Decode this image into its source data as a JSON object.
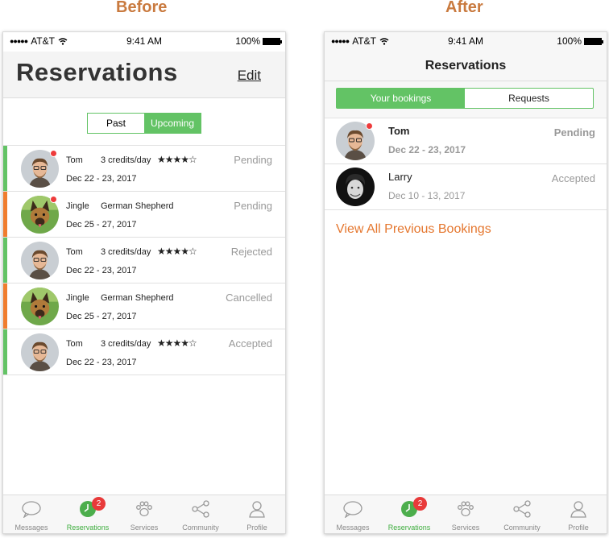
{
  "captions": {
    "before": "Before",
    "after": "After"
  },
  "statusbar": {
    "carrier": "AT&T",
    "time": "9:41 AM",
    "battery": "100%"
  },
  "before": {
    "title": "Reservations",
    "edit_label": "Edit",
    "segment": {
      "left": "Past",
      "right": "Upcoming"
    },
    "rows": [
      {
        "name": "Tom",
        "detail": "3 credits/day",
        "stars": "★★★★☆",
        "dates": "Dec 22 - 23, 2017",
        "status": "Pending",
        "bar_color": "#63c365",
        "avatar": "man",
        "unread": true
      },
      {
        "name": "Jingle",
        "detail": "German Shepherd",
        "stars": "",
        "dates": "Dec 25 - 27, 2017",
        "status": "Pending",
        "bar_color": "#f07d2e",
        "avatar": "dog",
        "unread": true
      },
      {
        "name": "Tom",
        "detail": "3 credits/day",
        "stars": "★★★★☆",
        "dates": "Dec 22 - 23, 2017",
        "status": "Rejected",
        "bar_color": "#63c365",
        "avatar": "man",
        "unread": false
      },
      {
        "name": "Jingle",
        "detail": "German Shepherd",
        "stars": "",
        "dates": "Dec 25 - 27, 2017",
        "status": "Cancelled",
        "bar_color": "#f07d2e",
        "avatar": "dog",
        "unread": false
      },
      {
        "name": "Tom",
        "detail": "3 credits/day",
        "stars": "★★★★☆",
        "dates": "Dec 22 - 23, 2017",
        "status": "Accepted",
        "bar_color": "#63c365",
        "avatar": "man",
        "unread": false
      }
    ]
  },
  "after": {
    "title": "Reservations",
    "segment": {
      "left": "Your bookings",
      "right": "Requests"
    },
    "rows": [
      {
        "name": "Tom",
        "dates": "Dec 22 - 23, 2017",
        "status": "Pending",
        "avatar": "man",
        "unread": true
      },
      {
        "name": "Larry",
        "dates": "Dec 10 - 13, 2017",
        "status": "Accepted",
        "avatar": "bw",
        "unread": false
      }
    ],
    "view_all": "View All Previous Bookings"
  },
  "tabbar": {
    "items": [
      {
        "label": "Messages",
        "icon": "chat-icon"
      },
      {
        "label": "Reservations",
        "icon": "clock-icon",
        "badge": "2"
      },
      {
        "label": "Services",
        "icon": "paw-icon"
      },
      {
        "label": "Community",
        "icon": "share-icon"
      },
      {
        "label": "Profile",
        "icon": "person-icon"
      }
    ]
  },
  "colors": {
    "green": "#63c365",
    "orange": "#f07d2e",
    "caption": "#c97a3f",
    "link": "#e5772f",
    "badge": "#e83a3a"
  }
}
